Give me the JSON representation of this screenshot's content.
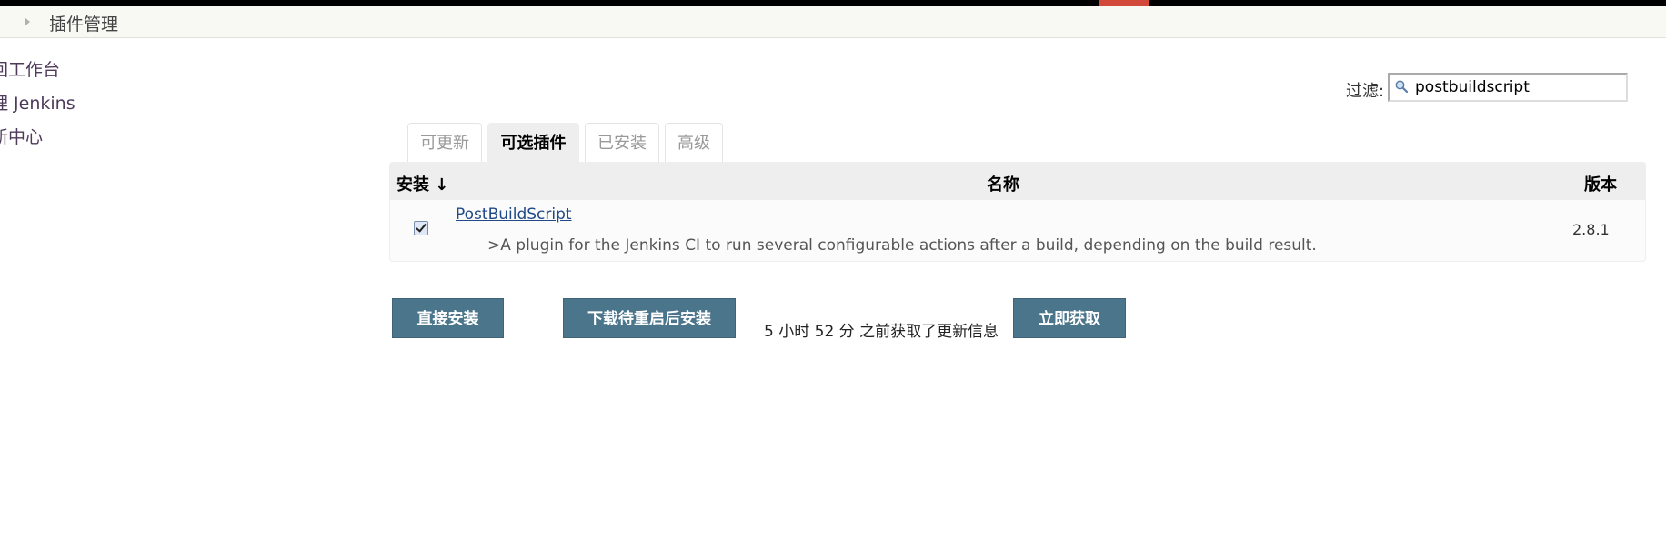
{
  "breadcrumb": {
    "current": "插件管理"
  },
  "sidebar": {
    "items": [
      {
        "label": "回工作台"
      },
      {
        "label": "理 Jenkins"
      },
      {
        "label": "新中心"
      }
    ]
  },
  "filter": {
    "label": "过滤:",
    "value": "postbuildscript",
    "icon": "search-icon"
  },
  "tabs": [
    {
      "label": "可更新",
      "active": false
    },
    {
      "label": "可选插件",
      "active": true
    },
    {
      "label": "已安装",
      "active": false
    },
    {
      "label": "高级",
      "active": false
    }
  ],
  "table": {
    "headers": {
      "install": "安装 ↓",
      "name": "名称",
      "version": "版本"
    },
    "rows": [
      {
        "checked": true,
        "name": "PostBuildScript",
        "description": ">A plugin for the Jenkins CI to run several configurable actions after a build, depending on the build result.",
        "version": "2.8.1"
      }
    ]
  },
  "actions": {
    "install_now": "直接安装",
    "install_after_restart": "下载待重启后安装",
    "update_status": "5 小时 52 分 之前获取了更新信息",
    "check_now": "立即获取"
  },
  "colors": {
    "accent": "#d24939",
    "button": "#4b758b",
    "link": "#204a87"
  }
}
